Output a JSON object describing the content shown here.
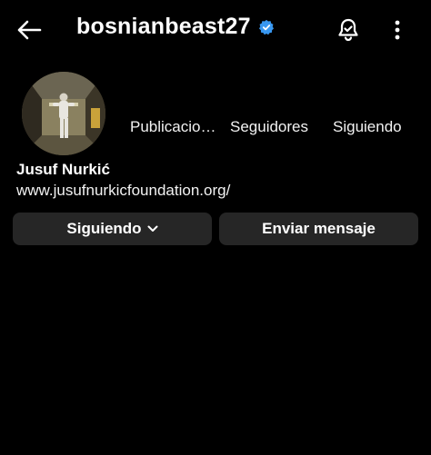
{
  "header": {
    "username": "bosnianbeast27"
  },
  "profile": {
    "stats": {
      "posts_label": "Publicacio…",
      "followers_label": "Seguidores",
      "following_label": "Siguiendo"
    },
    "name": "Jusuf Nurkić",
    "website": "www.jusufnurkicfoundation.org/"
  },
  "actions": {
    "following_button_label": "Siguiendo",
    "message_button_label": "Enviar mensaje"
  },
  "colors": {
    "background": "#000000",
    "button_bg": "#262626",
    "verified_blue": "#3897f0"
  },
  "icons": {
    "back": "arrow-left-icon",
    "verified": "verified-badge-icon",
    "notifications": "bell-icon",
    "more": "more-vertical-icon",
    "dropdown": "chevron-down-icon"
  }
}
